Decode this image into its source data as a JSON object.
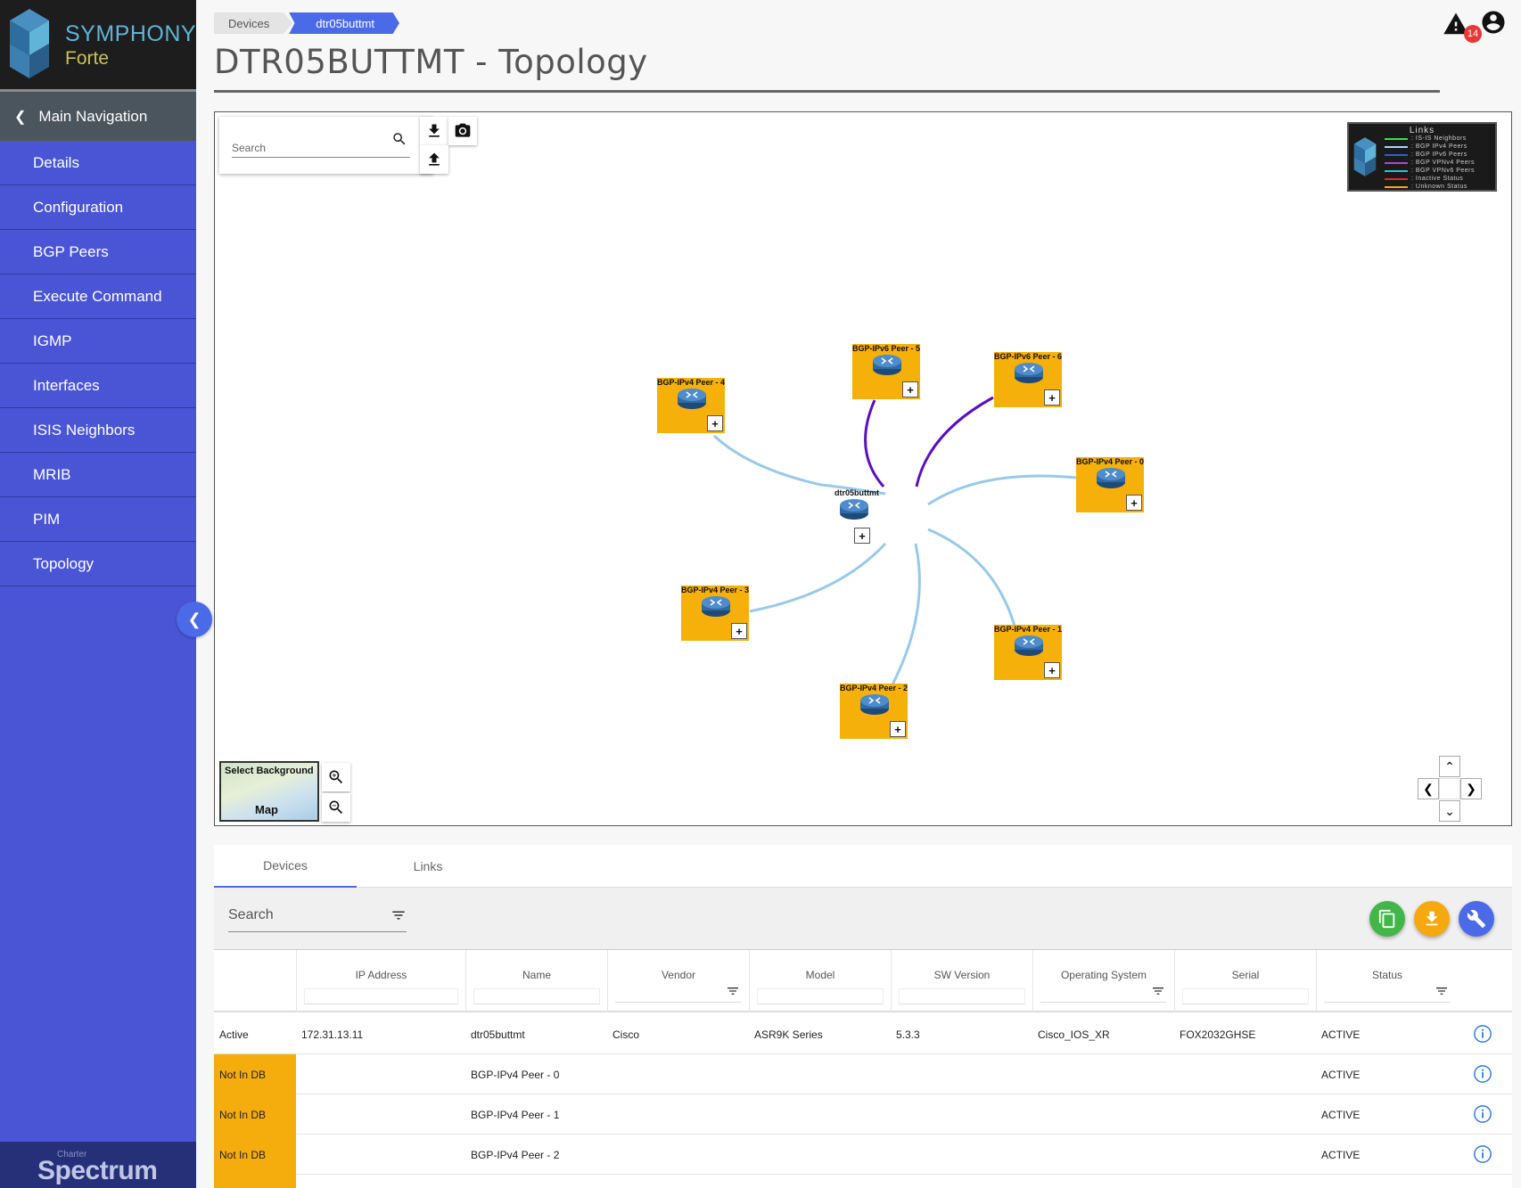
{
  "brand": {
    "title": "SYMPHONY",
    "subtitle": "Forte"
  },
  "sidebar": {
    "main_nav_label": "Main Navigation",
    "items": [
      {
        "label": "Details"
      },
      {
        "label": "Configuration"
      },
      {
        "label": "BGP Peers"
      },
      {
        "label": "Execute Command"
      },
      {
        "label": "IGMP"
      },
      {
        "label": "Interfaces"
      },
      {
        "label": "ISIS Neighbors"
      },
      {
        "label": "MRIB"
      },
      {
        "label": "PIM"
      },
      {
        "label": "Topology"
      }
    ],
    "footer_small": "Charter",
    "footer_logo": "Spectrum"
  },
  "breadcrumb": {
    "items": [
      {
        "label": "Devices"
      },
      {
        "label": "dtr05buttmt"
      }
    ]
  },
  "page": {
    "title": "DTR05BUTTMT - Topology"
  },
  "alerts": {
    "count": "14"
  },
  "topology": {
    "search_placeholder": "Search",
    "legend": {
      "title": "Links",
      "items": [
        {
          "label": ": IS-IS Neighbors",
          "color": "#39e04a"
        },
        {
          "label": ": BGP IPv4 Peers",
          "color": "#a8d6f5"
        },
        {
          "label": ": BGP IPv6 Peers",
          "color": "#3a55e8"
        },
        {
          "label": ": BGP VPNv4 Peers",
          "color": "#b04ac8"
        },
        {
          "label": ": BGP VPNv6 Peers",
          "color": "#26c8c8"
        },
        {
          "label": ": Inactive Status",
          "color": "#e02a2a"
        },
        {
          "label": ": Unknown Status",
          "color": "#f2a916"
        }
      ]
    },
    "background_select": {
      "line1": "Select Background",
      "line2": "Map"
    },
    "center_node": "dtr05buttmt",
    "nodes": [
      {
        "label": "BGP-IPv4 Peer - 4",
        "link": "ipv4"
      },
      {
        "label": "BGP-IPv6 Peer - 5",
        "link": "ipv6"
      },
      {
        "label": "BGP-IPv6 Peer - 6",
        "link": "ipv6"
      },
      {
        "label": "BGP-IPv4 Peer - 0",
        "link": "ipv4"
      },
      {
        "label": "BGP-IPv4 Peer - 3",
        "link": "ipv4"
      },
      {
        "label": "BGP-IPv4 Peer - 1",
        "link": "ipv4"
      },
      {
        "label": "BGP-IPv4 Peer - 2",
        "link": "ipv4"
      }
    ],
    "node_color": "#f5b00a",
    "ipv4_link_color": "#98c9ea",
    "ipv6_link_color": "#5a10c0"
  },
  "bottom": {
    "tabs": [
      {
        "label": "Devices"
      },
      {
        "label": "Links"
      }
    ],
    "search_label": "Search",
    "columns": [
      "",
      "IP Address",
      "Name",
      "Vendor",
      "Model",
      "SW Version",
      "Operating System",
      "Serial",
      "Status"
    ],
    "rows": [
      {
        "state": "Active",
        "ip": "172.31.13.11",
        "name": "dtr05buttmt",
        "vendor": "Cisco",
        "model": "ASR9K Series",
        "sw": "5.3.3",
        "os": "Cisco_IOS_XR",
        "serial": "FOX2032GHSE",
        "status": "ACTIVE"
      },
      {
        "state": "Not In DB",
        "ip": "",
        "name": "BGP-IPv4 Peer - 0",
        "vendor": "",
        "model": "",
        "sw": "",
        "os": "",
        "serial": "",
        "status": "ACTIVE"
      },
      {
        "state": "Not In DB",
        "ip": "",
        "name": "BGP-IPv4 Peer - 1",
        "vendor": "",
        "model": "",
        "sw": "",
        "os": "",
        "serial": "",
        "status": "ACTIVE"
      },
      {
        "state": "Not In DB",
        "ip": "",
        "name": "BGP-IPv4 Peer - 2",
        "vendor": "",
        "model": "",
        "sw": "",
        "os": "",
        "serial": "",
        "status": "ACTIVE"
      }
    ],
    "fab_colors": {
      "copy": "#43b649",
      "download": "#f5a90e",
      "tools": "#4a6ae8"
    },
    "notdb_color": "#f5ad0e"
  }
}
